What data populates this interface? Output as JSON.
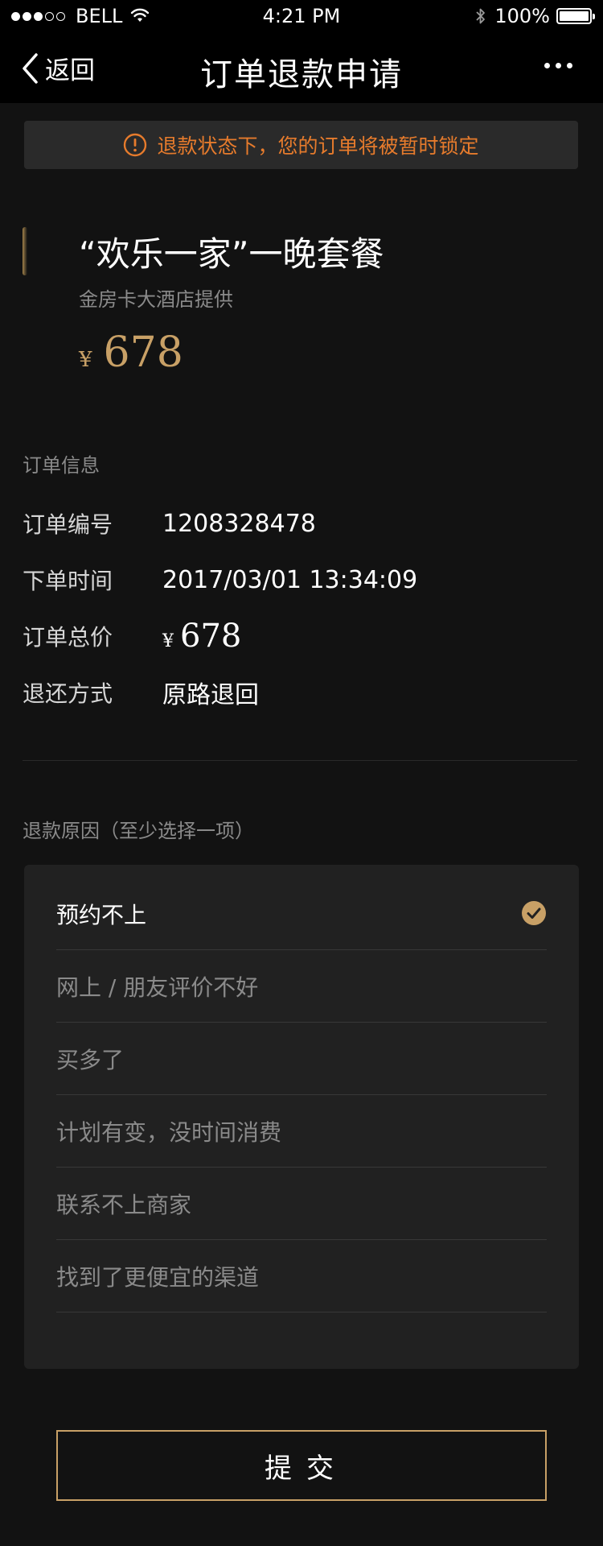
{
  "status_bar": {
    "carrier": "BELL",
    "time": "4:21 PM",
    "battery": "100%"
  },
  "nav": {
    "back_label": "返回",
    "title": "订单退款申请"
  },
  "notice": {
    "text": "退款状态下，您的订单将被暂时锁定",
    "color": "#e67b2c"
  },
  "product": {
    "title": "“欢乐一家”一晚套餐",
    "vendor": "金房卡大酒店提供",
    "currency": "¥",
    "price": "678"
  },
  "order_info": {
    "section_label": "订单信息",
    "rows": [
      {
        "label": "订单编号",
        "value": "1208328478"
      },
      {
        "label": "下单时间",
        "value": "2017/03/01 13:34:09"
      },
      {
        "label": "订单总价",
        "currency": "¥",
        "value": "678"
      },
      {
        "label": "退还方式",
        "value": "原路退回"
      }
    ]
  },
  "refund_reasons": {
    "section_label": "退款原因（至少选择一项）",
    "items": [
      {
        "label": "预约不上",
        "selected": true
      },
      {
        "label": "网上 / 朋友评价不好",
        "selected": false
      },
      {
        "label": "买多了",
        "selected": false
      },
      {
        "label": "计划有变，没时间消费",
        "selected": false
      },
      {
        "label": "联系不上商家",
        "selected": false
      },
      {
        "label": "找到了更便宜的渠道",
        "selected": false
      }
    ]
  },
  "submit": {
    "label": "提交"
  },
  "colors": {
    "accent_gold": "#c8a066",
    "background": "#121212",
    "panel": "#212121"
  }
}
